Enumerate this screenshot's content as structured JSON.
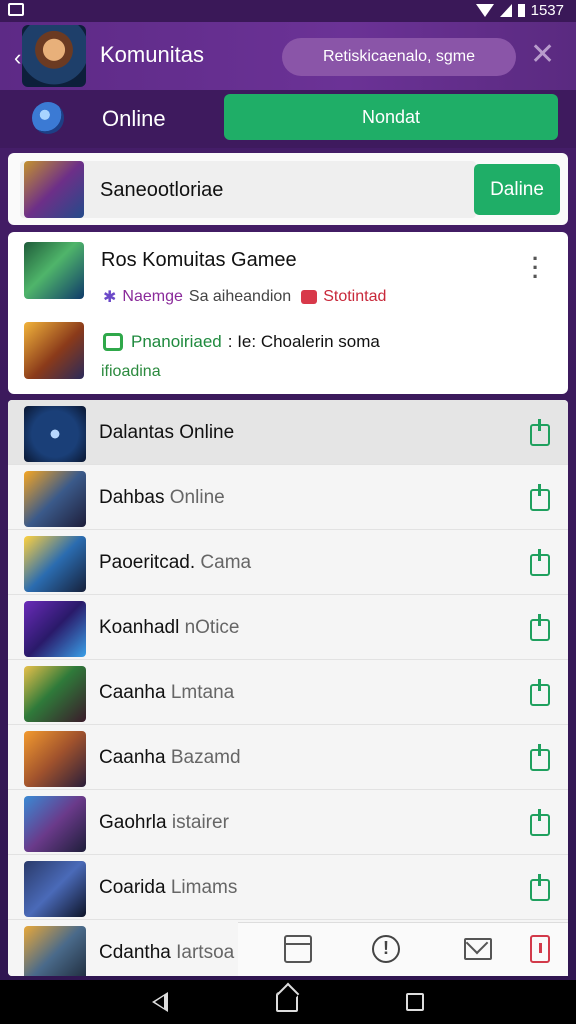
{
  "status_bar": {
    "time": "1537"
  },
  "app_bar": {
    "title": "Komunitas",
    "search_text": "Retiskicaenalo, sgme"
  },
  "online_row": {
    "label": "Online",
    "button": "Nondat"
  },
  "card1": {
    "text": "Saneootloriae",
    "button": "Daline"
  },
  "card2": {
    "title": "Ros Komuitas Gamee",
    "tag1": "Naemge",
    "tag2": "Sa aiheandion",
    "tag3": "Stotintad",
    "chat_green": "Pnanoiriaed",
    "chat_dark": ": Ie: Choalerin soma",
    "chat_sub": "ifioadina"
  },
  "list": [
    {
      "title": "Dalantas Online",
      "sub": ""
    },
    {
      "title": "Dahbas",
      "sub": "Online"
    },
    {
      "title": "Paoeritcad.",
      "sub": "Cama"
    },
    {
      "title": "Koanhadl",
      "sub": "nOtice"
    },
    {
      "title": "Caanha",
      "sub": "Lmtana"
    },
    {
      "title": "Caanha",
      "sub": "Bazamd"
    },
    {
      "title": "Gaohrla",
      "sub": "istairer"
    },
    {
      "title": "Coarida",
      "sub": "Limams"
    },
    {
      "title": "Cdantha",
      "sub": "Iartsoa"
    }
  ],
  "colors": {
    "accent_green": "#1fae67",
    "header_purple": "#5d2a86"
  }
}
